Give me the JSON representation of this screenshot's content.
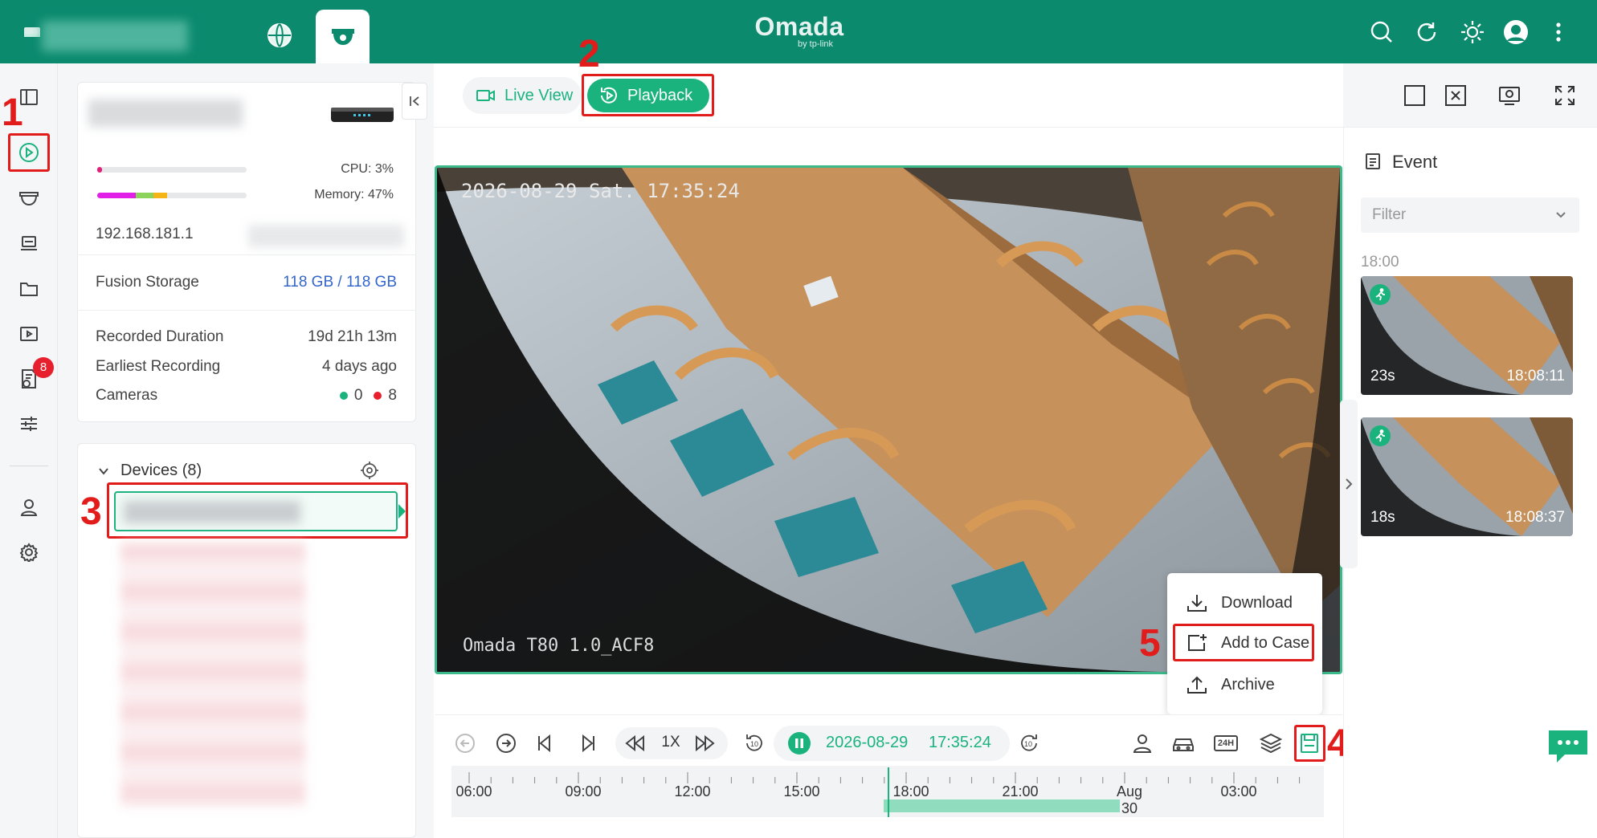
{
  "header": {
    "brand": "Omada",
    "brand_sub": "by tp-link"
  },
  "tabs": {
    "live_view": "Live View",
    "playback": "Playback"
  },
  "nvr": {
    "cpu": "CPU: 3%",
    "cpu_percent": 3,
    "memory": "Memory: 47%",
    "memory_percent": 47,
    "ip": "192.168.181.1",
    "storage_label": "Fusion Storage",
    "storage_value": "118 GB / 118 GB",
    "recorded_duration_label": "Recorded Duration",
    "recorded_duration_value": "19d 21h 13m",
    "earliest_recording_label": "Earliest Recording",
    "earliest_recording_value": "4 days ago",
    "cameras_label": "Cameras",
    "cameras_online": "0",
    "cameras_offline": "8"
  },
  "sidebar": {
    "badge_count": "8"
  },
  "devices": {
    "title": "Devices (8)"
  },
  "video": {
    "osd_timestamp": "2026-08-29 Sat. 17:35:24",
    "osd_camera": "Omada T80 1.0_ACF8"
  },
  "event": {
    "title": "Event",
    "filter_placeholder": "Filter",
    "hour_label": "18:00",
    "items": [
      {
        "duration": "23s",
        "time": "18:08:11"
      },
      {
        "duration": "18s",
        "time": "18:08:37"
      }
    ]
  },
  "context_menu": {
    "download": "Download",
    "add_to_case": "Add to Case",
    "archive": "Archive"
  },
  "controls": {
    "speed": "1X",
    "date": "2026-08-29",
    "time": "17:35:24",
    "skip_back": "10",
    "skip_fwd": "10",
    "label_24h": "24H"
  },
  "timeline": {
    "labels": [
      "06:00",
      "09:00",
      "12:00",
      "15:00",
      "18:00",
      "21:00",
      "Aug 30",
      "03:00"
    ]
  },
  "steps": [
    "1",
    "2",
    "3",
    "4",
    "5"
  ],
  "colors": {
    "brand_green": "#0b8a6e",
    "accent_green": "#1ab37e",
    "highlight_red": "#e21b1b"
  }
}
